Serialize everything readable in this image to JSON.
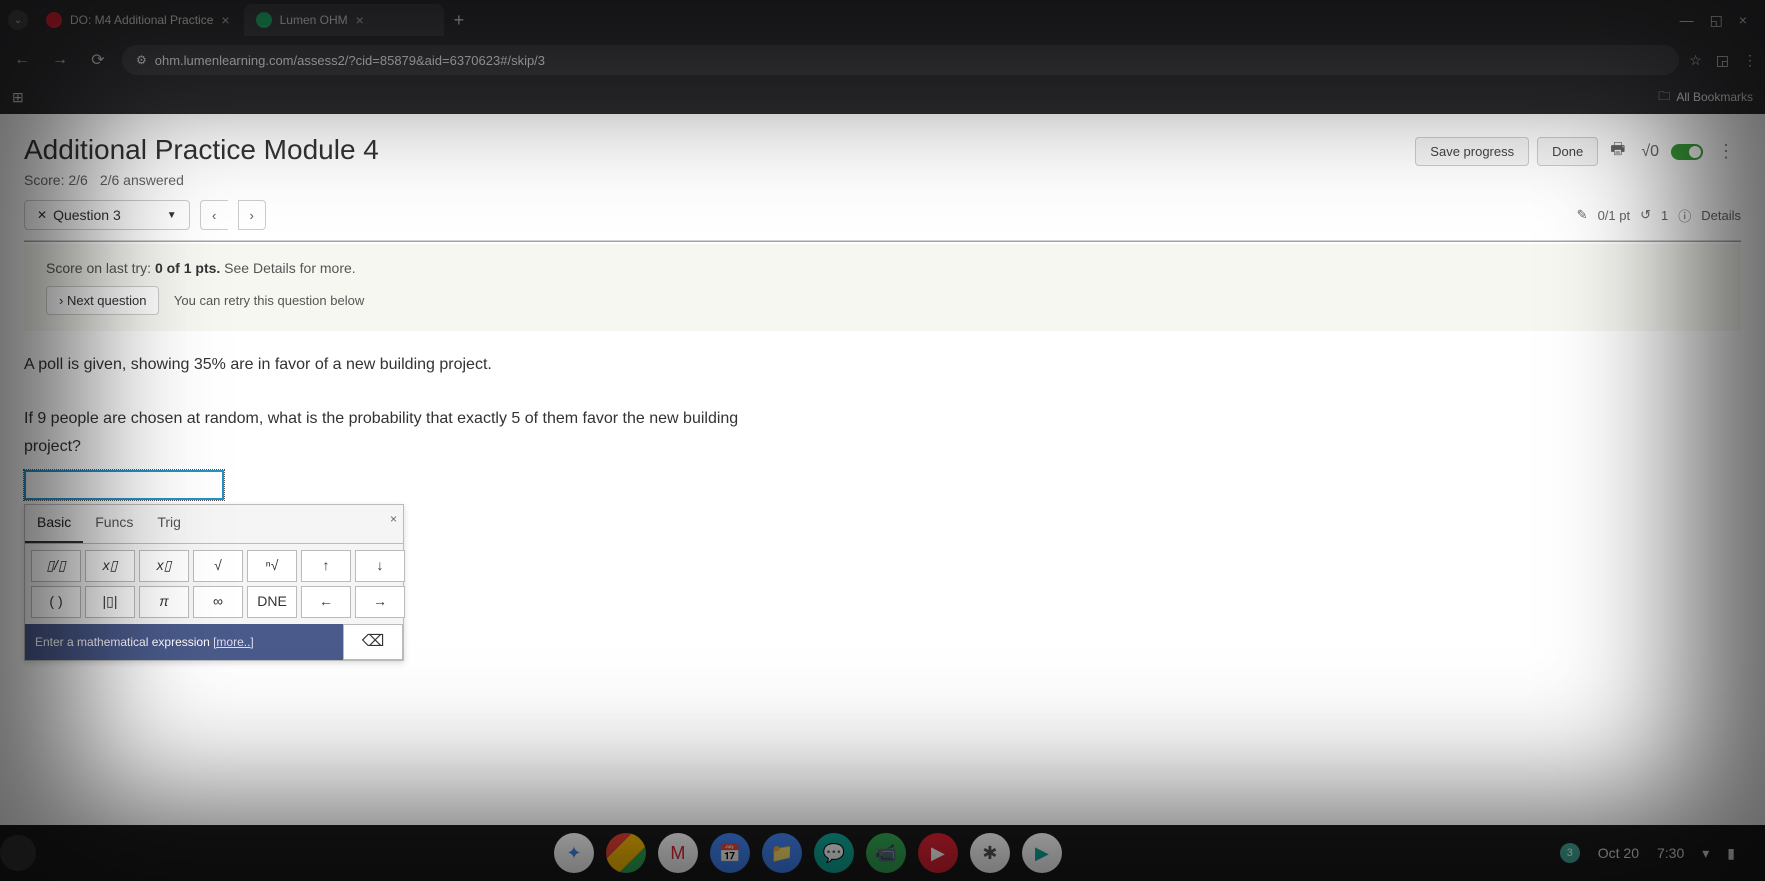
{
  "browser": {
    "tabs": [
      {
        "title": "DO: M4 Additional Practice",
        "icon_color": "#d23",
        "active": false
      },
      {
        "title": "Lumen OHM",
        "icon_color": "#2a6",
        "active": true
      }
    ],
    "url": "ohm.lumenlearning.com/assess2/?cid=85879&aid=6370623#/skip/3",
    "bookmarks_label": "All Bookmarks"
  },
  "header": {
    "title": "Additional Practice Module 4",
    "score": "Score: 2/6",
    "answered": "2/6 answered",
    "save_label": "Save progress",
    "done_label": "Done",
    "formula_icon": "√0"
  },
  "question_nav": {
    "label": "Question 3",
    "points": "0/1 pt",
    "retries": "1",
    "details_label": "Details"
  },
  "feedback": {
    "prefix": "Score on last try: ",
    "bold": "0 of 1 pts.",
    "suffix": " See Details for more.",
    "next_label": "Next question",
    "retry_text": "You can retry this question below"
  },
  "question": {
    "line1": "A poll is given, showing 35% are in favor of a new building project.",
    "line2": "If 9 people are chosen at random, what is the probability that exactly 5 of them favor the new building project?"
  },
  "keypad": {
    "tabs": {
      "basic": "Basic",
      "funcs": "Funcs",
      "trig": "Trig"
    },
    "row1": [
      "▯/▯",
      "x▯",
      "x▯",
      "√",
      "ⁿ√",
      "↑",
      "↓"
    ],
    "row2": [
      "( )",
      "|▯|",
      "π",
      "∞",
      "DNE",
      "←",
      "→"
    ],
    "hint_prefix": "Enter a mathematical expression ",
    "hint_link": "[more..]"
  },
  "taskbar": {
    "apps": [
      "✦",
      "●",
      "M",
      "📅",
      "📁",
      "💬",
      "📹",
      "▶",
      "✱",
      "▶"
    ],
    "badge": "3",
    "date": "Oct 20",
    "time": "7:30"
  }
}
